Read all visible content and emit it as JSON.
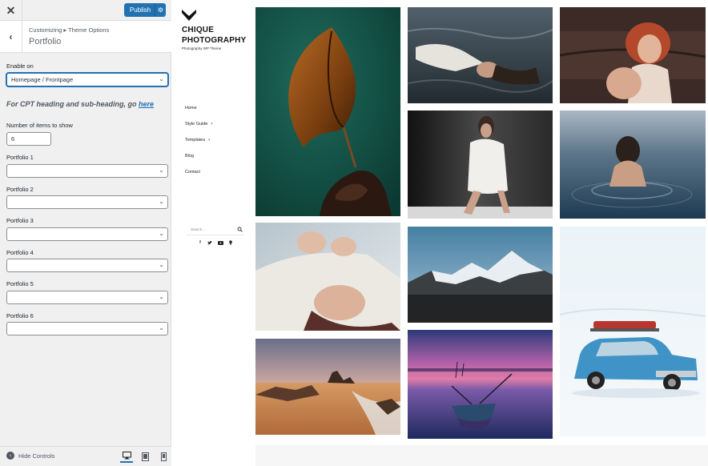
{
  "customizer": {
    "close_icon": "close-icon",
    "publish_label": "Publish",
    "breadcrumb": "Customizing ▸ Theme Options",
    "section_title": "Portfolio",
    "enable_on": {
      "label": "Enable on",
      "value": "Homepage / Frontpage"
    },
    "cpt_note_prefix": "For CPT heading and sub-heading, go ",
    "cpt_note_link": "here",
    "items_count": {
      "label": "Number of items to show",
      "value": "6"
    },
    "portfolios": [
      {
        "label": "Portfolio 1",
        "value": ""
      },
      {
        "label": "Portfolio 2",
        "value": ""
      },
      {
        "label": "Portfolio 3",
        "value": ""
      },
      {
        "label": "Portfolio 4",
        "value": ""
      },
      {
        "label": "Portfolio 5",
        "value": ""
      },
      {
        "label": "Portfolio 6",
        "value": ""
      }
    ],
    "hide_controls": "Hide Controls",
    "accent": "#2271b1"
  },
  "site": {
    "title_line1": "CHIQUE",
    "title_line2": "PHOTOGRAPHY",
    "tagline": "Photography WP Theme",
    "nav": [
      {
        "label": "Home",
        "has_sub": false
      },
      {
        "label": "Style Guide",
        "has_sub": true
      },
      {
        "label": "Templates",
        "has_sub": true
      },
      {
        "label": "Blog",
        "has_sub": false
      },
      {
        "label": "Contact",
        "has_sub": false
      }
    ],
    "search_placeholder": "Search ...",
    "social": [
      "facebook-icon",
      "twitter-icon",
      "youtube-icon",
      "rss-icon"
    ]
  },
  "gallery": {
    "photos": [
      "dry-leaf-in-hand",
      "woman-lying-in-water",
      "laughing-redhead-woman",
      "woman-in-white-sweater-dress",
      "woman-swimming-in-lake",
      "woman-lying-in-white-sweater",
      "snowy-mountain-peaks",
      "blue-car-in-snow",
      "sunset-beach-rocks",
      "boat-on-purple-lake"
    ]
  }
}
